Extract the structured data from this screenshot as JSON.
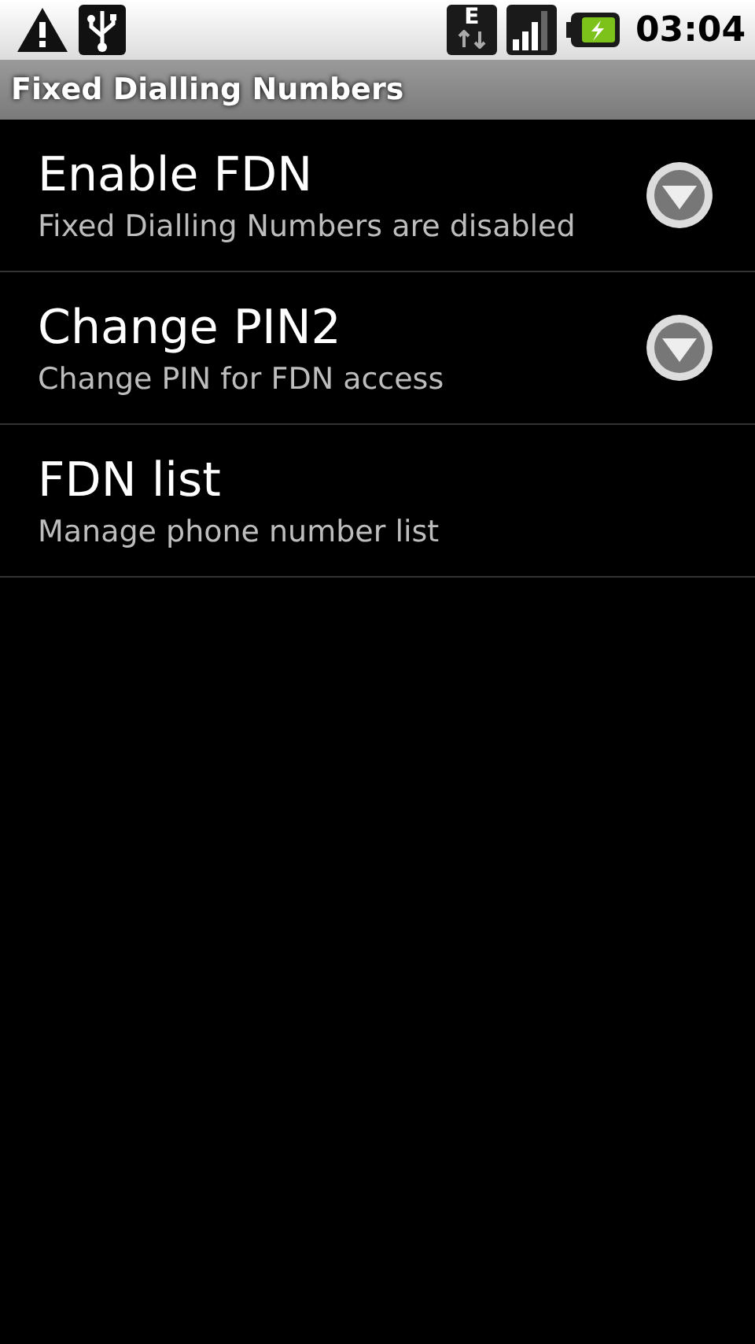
{
  "status_bar": {
    "network_type": "E",
    "time": "03:04"
  },
  "title_bar": {
    "title": "Fixed Dialling Numbers"
  },
  "items": [
    {
      "title": "Enable FDN",
      "summary": "Fixed Dialling Numbers are disabled",
      "kind": "dialog"
    },
    {
      "title": "Change PIN2",
      "summary": "Change PIN for FDN access",
      "kind": "dialog"
    },
    {
      "title": "FDN list",
      "summary": "Manage phone number list",
      "kind": "screen"
    }
  ]
}
